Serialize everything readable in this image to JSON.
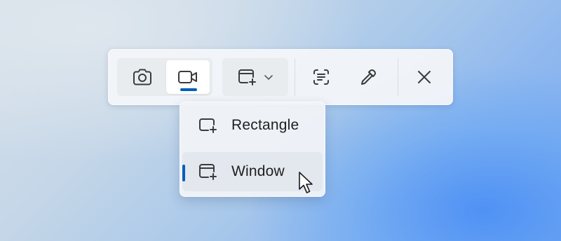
{
  "toolbar": {
    "capture_modes": [
      {
        "name": "screenshot",
        "icon": "camera-icon",
        "selected": false
      },
      {
        "name": "video",
        "icon": "video-camera-icon",
        "selected": true
      }
    ],
    "shape_dropdown": {
      "icon": "window-snip-icon",
      "chevron": "chevron-down-icon"
    },
    "tools": [
      {
        "name": "text-extractor",
        "icon": "text-scan-icon"
      },
      {
        "name": "color-picker",
        "icon": "eyedropper-icon"
      },
      {
        "name": "close",
        "icon": "close-icon"
      }
    ]
  },
  "dropdown": {
    "items": [
      {
        "label": "Rectangle",
        "icon": "rectangle-snip-icon",
        "selected": false
      },
      {
        "label": "Window",
        "icon": "window-snip-icon",
        "selected": true
      }
    ]
  },
  "colors": {
    "accent": "#005fb8",
    "toolbar_bg": "#f3f5f8",
    "icon": "#3b3b3b"
  }
}
